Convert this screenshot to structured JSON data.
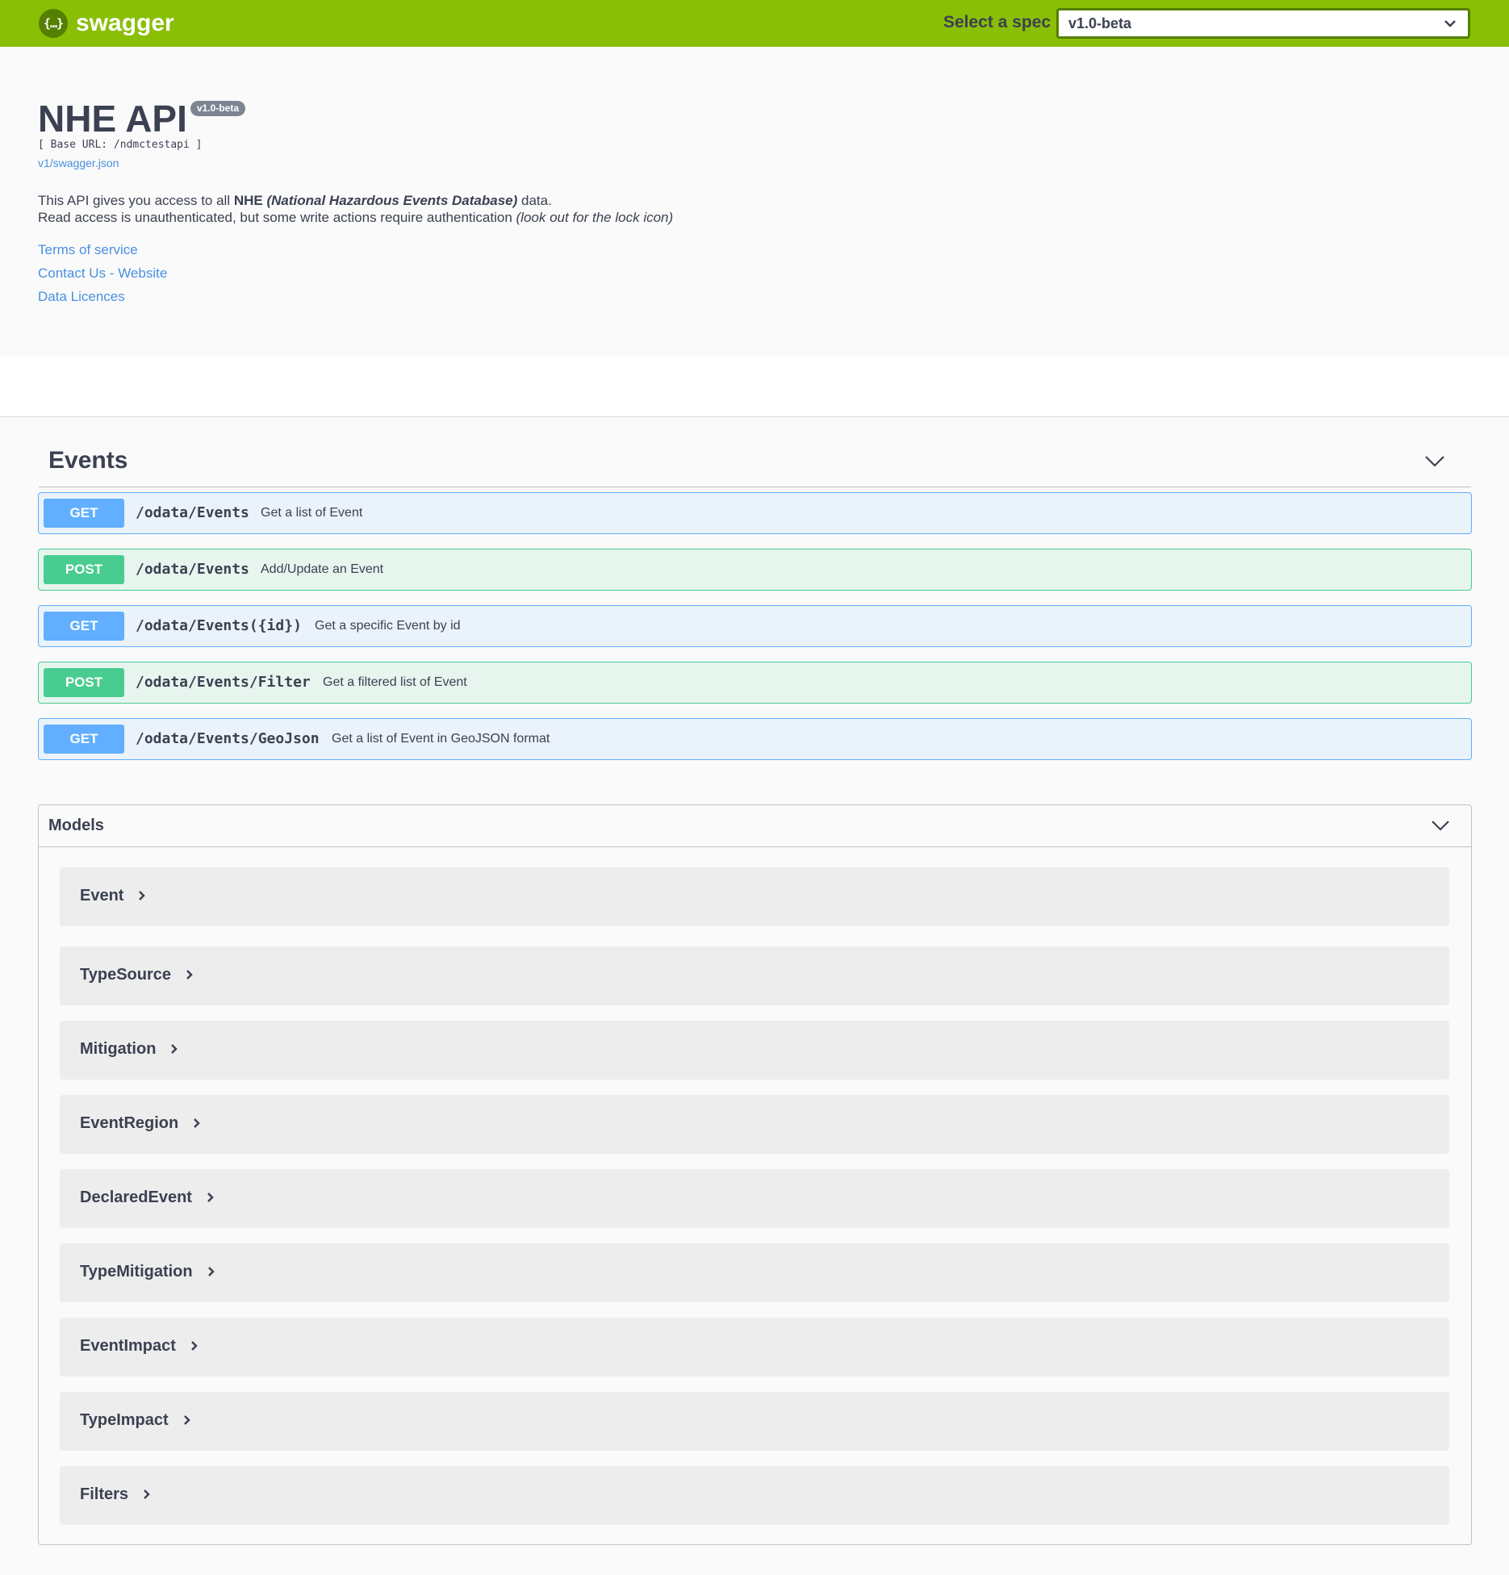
{
  "topbar": {
    "logo_glyph": "{…}",
    "logo_text": "swagger",
    "spec_label": "Select a spec",
    "spec_value": "v1.0-beta",
    "brand_color": "#89bf04"
  },
  "info": {
    "title": "NHE API",
    "version": "v1.0-beta",
    "base_url": "[ Base URL: /ndmctestapi ]",
    "spec_link": "v1/swagger.json",
    "description": {
      "line1_a": "This API gives you access to all ",
      "line1_b": "NHE",
      "line1_c": " (National Hazardous Events Database)",
      "line1_d": " data.",
      "line2_a": "Read access is unauthenticated, but some write actions require authentication ",
      "line2_b": "(look out for the lock icon)"
    },
    "links": [
      "Terms of service",
      "Contact Us - Website",
      "Data Licences"
    ]
  },
  "events": {
    "title": "Events",
    "operations": [
      {
        "method": "GET",
        "path": "/odata/Events",
        "summary": "Get a list of Event"
      },
      {
        "method": "POST",
        "path": "/odata/Events",
        "summary": "Add/Update an Event"
      },
      {
        "method": "GET",
        "path": "/odata/Events({id})",
        "summary": "Get a specific Event by id"
      },
      {
        "method": "POST",
        "path": "/odata/Events/Filter",
        "summary": "Get a filtered list of Event"
      },
      {
        "method": "GET",
        "path": "/odata/Events/GeoJson",
        "summary": "Get a list of Event in GeoJSON format"
      }
    ]
  },
  "models": {
    "title": "Models",
    "items": [
      "Event",
      "TypeSource",
      "Mitigation",
      "EventRegion",
      "DeclaredEvent",
      "TypeMitigation",
      "EventImpact",
      "TypeImpact",
      "Filters"
    ]
  }
}
